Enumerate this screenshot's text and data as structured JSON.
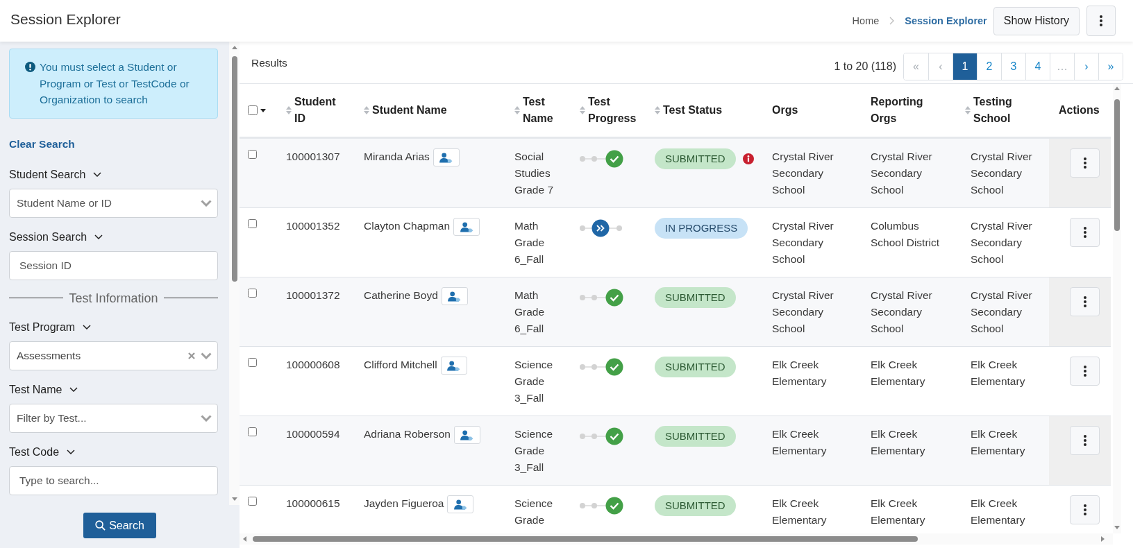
{
  "header": {
    "title": "Session Explorer",
    "breadcrumbs": [
      {
        "label": "Home",
        "current": false
      },
      {
        "label": "Session Explorer",
        "current": true
      }
    ],
    "history_button": "Show History"
  },
  "sidebar": {
    "alert": "You must select a Student or Program or Test or TestCode or Organization to search",
    "clear_link": "Clear Search",
    "fields": [
      {
        "kind": "select",
        "label": "Student Search",
        "placeholder": "Student Name or ID"
      },
      {
        "kind": "input",
        "label": "Session Search",
        "placeholder": "Session ID"
      },
      {
        "kind": "divider",
        "label": "Test Information"
      },
      {
        "kind": "select",
        "label": "Test Program",
        "value": "Assessments"
      },
      {
        "kind": "select",
        "label": "Test Name",
        "placeholder": "Filter by Test..."
      },
      {
        "kind": "input",
        "label": "Test Code",
        "placeholder": "Type to search..."
      }
    ],
    "search_button": "Search"
  },
  "results": {
    "title": "Results",
    "range": "1 to 20 (118)",
    "pages": [
      {
        "label": "«",
        "selected": false,
        "disabled": true
      },
      {
        "label": "‹",
        "selected": false,
        "disabled": true
      },
      {
        "label": "1",
        "selected": true,
        "disabled": false
      },
      {
        "label": "2",
        "selected": false,
        "disabled": false
      },
      {
        "label": "3",
        "selected": false,
        "disabled": false
      },
      {
        "label": "4",
        "selected": false,
        "disabled": false
      },
      {
        "label": "…",
        "selected": false,
        "disabled": true
      },
      {
        "label": "›",
        "selected": false,
        "disabled": false
      },
      {
        "label": "»",
        "selected": false,
        "disabled": false
      }
    ],
    "select_all": {
      "checked": false
    },
    "columns": [
      {
        "label": "Student ID",
        "sortable": true
      },
      {
        "label": "Student Name",
        "sortable": true
      },
      {
        "label": "Test Name",
        "sortable": true
      },
      {
        "label": "Test Progress",
        "sortable": true
      },
      {
        "label": "Test Status",
        "sortable": true
      },
      {
        "label": "Orgs",
        "sortable": false
      },
      {
        "label": "Reporting Orgs",
        "sortable": false
      },
      {
        "label": "Testing School",
        "sortable": true
      },
      {
        "label": "Actions",
        "sortable": false
      }
    ],
    "rows": [
      {
        "selected": false,
        "student_id": "100001307",
        "student_name": "Miranda Arias",
        "test_name": "Social Studies Grade 7",
        "progress": {
          "kind": "complete"
        },
        "status": {
          "label": "SUBMITTED",
          "kind": "submitted"
        },
        "flagged": true,
        "orgs": "Crystal River Secondary School",
        "reporting_orgs": "Crystal River Secondary School",
        "testing_school": "Crystal River Secondary School"
      },
      {
        "selected": false,
        "student_id": "100001352",
        "student_name": "Clayton Chapman",
        "test_name": "Math Grade 6_Fall",
        "progress": {
          "kind": "in_progress"
        },
        "status": {
          "label": "IN PROGRESS",
          "kind": "in_progress"
        },
        "flagged": false,
        "orgs": "Crystal River Secondary School",
        "reporting_orgs": "Columbus School District",
        "testing_school": "Crystal River Secondary School"
      },
      {
        "selected": false,
        "student_id": "100001372",
        "student_name": "Catherine Boyd",
        "test_name": "Math Grade 6_Fall",
        "progress": {
          "kind": "complete"
        },
        "status": {
          "label": "SUBMITTED",
          "kind": "submitted"
        },
        "flagged": false,
        "orgs": "Crystal River Secondary School",
        "reporting_orgs": "Crystal River Secondary School",
        "testing_school": "Crystal River Secondary School"
      },
      {
        "selected": false,
        "student_id": "100000608",
        "student_name": "Clifford Mitchell",
        "test_name": "Science Grade 3_Fall",
        "progress": {
          "kind": "complete"
        },
        "status": {
          "label": "SUBMITTED",
          "kind": "submitted"
        },
        "flagged": false,
        "orgs": "Elk Creek Elementary",
        "reporting_orgs": "Elk Creek Elementary",
        "testing_school": "Elk Creek Elementary"
      },
      {
        "selected": false,
        "student_id": "100000594",
        "student_name": "Adriana Roberson",
        "test_name": "Science Grade 3_Fall",
        "progress": {
          "kind": "complete"
        },
        "status": {
          "label": "SUBMITTED",
          "kind": "submitted"
        },
        "flagged": false,
        "orgs": "Elk Creek Elementary",
        "reporting_orgs": "Elk Creek Elementary",
        "testing_school": "Elk Creek Elementary"
      },
      {
        "selected": false,
        "student_id": "100000615",
        "student_name": "Jayden Figueroa",
        "test_name": "Science Grade",
        "progress": {
          "kind": "complete"
        },
        "status": {
          "label": "SUBMITTED",
          "kind": "submitted"
        },
        "flagged": false,
        "orgs": "Elk Creek Elementary",
        "reporting_orgs": "Elk Creek Elementary",
        "testing_school": "Elk Creek Elementary"
      }
    ]
  }
}
